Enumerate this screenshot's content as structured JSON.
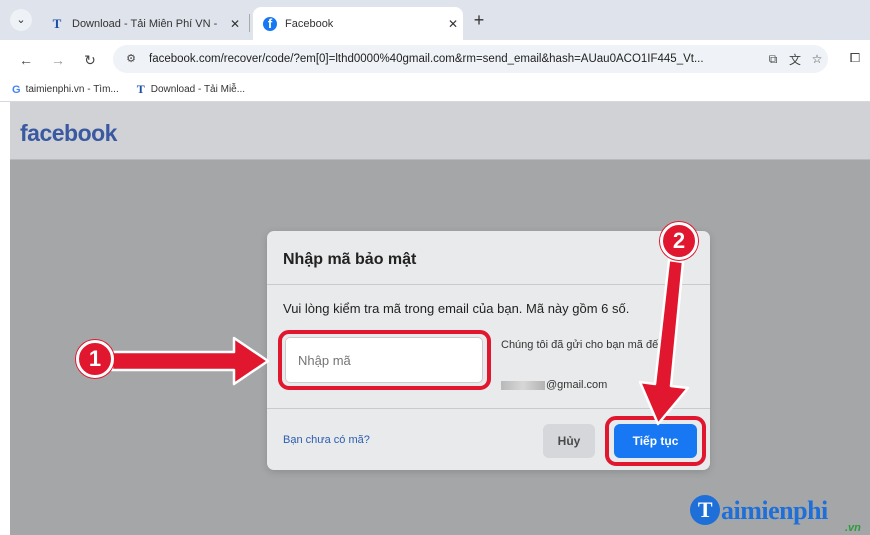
{
  "browser": {
    "tabs": [
      {
        "title": "Download - Tải Miễn Phí VN - ",
        "favicon": "taimienphi-t-icon",
        "active": false
      },
      {
        "title": "Facebook",
        "favicon": "facebook-icon",
        "active": true
      }
    ],
    "tab_close_glyph": "✕",
    "new_tab_glyph": "+",
    "url": "facebook.com/recover/code/?em[0]=lthd0000%40gmail.com&rm=send_email&hash=AUau0ACO1IF445_Vt...",
    "bookmarks": [
      {
        "label": "taimienphi.vn - Tìm...",
        "icon": "google-icon"
      },
      {
        "label": "Download - Tải Miễ...",
        "icon": "taimienphi-t-icon"
      }
    ]
  },
  "page": {
    "logo": "facebook",
    "modal": {
      "title": "Nhập mã bảo mật",
      "instruction": "Vui lòng kiểm tra mã trong email của bạn. Mã này gồm 6 số.",
      "code_placeholder": "Nhập mã",
      "sent_note": "Chúng tôi đã gửi cho bạn mã đến:",
      "email_suffix": "@gmail.com",
      "no_code_link": "Bạn chưa có mã?",
      "cancel_label": "Hủy",
      "continue_label": "Tiếp tục"
    }
  },
  "annotations": {
    "step1": "1",
    "step2": "2",
    "color": "#e0172e"
  },
  "watermark": {
    "initial": "T",
    "text": "aimienphi",
    "suffix": ".vn"
  },
  "colors": {
    "facebook_blue": "#1877f2",
    "logo_blue": "#3b59a0",
    "overlay_gray": "#a4a6a8"
  }
}
